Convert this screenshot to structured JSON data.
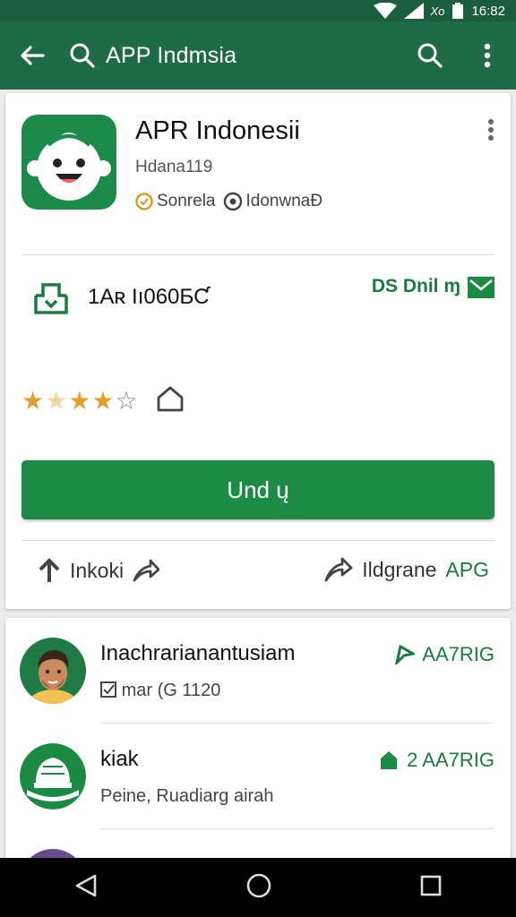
{
  "status_bar": {
    "time": "16:82",
    "network_label": "Xo"
  },
  "app_bar": {
    "title": "APP Indmsia"
  },
  "app": {
    "name": "APR Indonesii",
    "developer": "Hdana119",
    "meta_left": "Sonrela",
    "meta_right": "IdonwnaÐ",
    "downloads": "1Aʀ Iı060ƂƇ",
    "ds_label": "DS Dnil ɱ",
    "rating_stars": 3.5,
    "install_label": "Und ų",
    "action_left_label": "Inkoki",
    "action_right_prefix": "Ildgrane",
    "action_right_green": "APG"
  },
  "related": [
    {
      "title": "Inachrarianantusiam",
      "subtitle": "mar (G 1120",
      "right_label": "AA7RIG"
    },
    {
      "title": "kiak",
      "subtitle": "Peine, Ruadiarg airah",
      "right_label": "2  AA7RIG"
    }
  ],
  "colors": {
    "primary": "#1f6b47",
    "status_bar": "#1b5e3f",
    "install_button": "#1e8a48",
    "accent_text": "#1b7a3f",
    "star": "#e0a030"
  },
  "icons": [
    "back-arrow-icon",
    "search-icon",
    "more-vert-icon",
    "download-icon",
    "mail-icon",
    "star-icon",
    "wishlist-icon",
    "share-icon",
    "nav-back-icon",
    "nav-home-icon",
    "nav-recents-icon"
  ]
}
